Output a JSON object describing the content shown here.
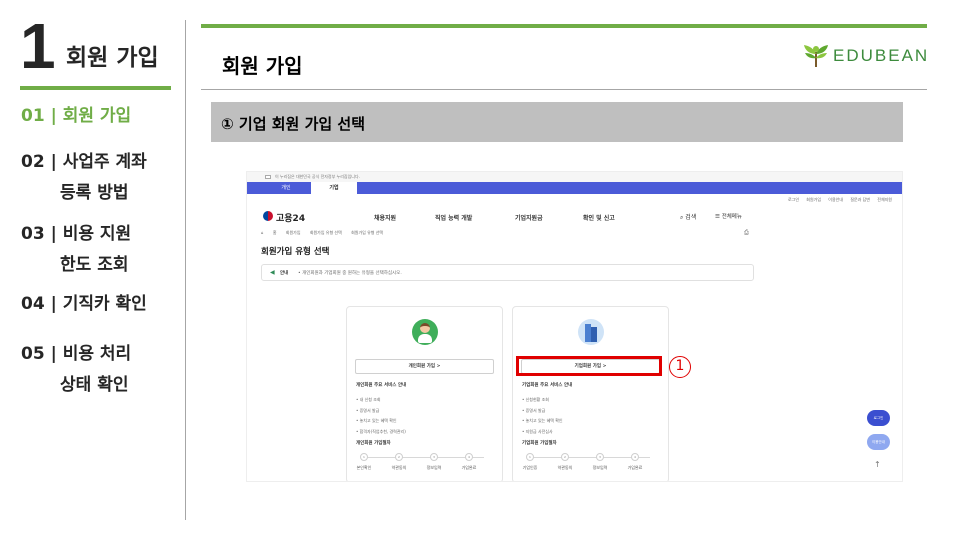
{
  "chapter": {
    "number": "1",
    "title": "회원 가입"
  },
  "nav": [
    {
      "line1": "01 | 회원 가입",
      "line2": "",
      "active": true
    },
    {
      "line1": "02 | 사업주 계좌",
      "line2": "등록 방법",
      "active": false
    },
    {
      "line1": "03 | 비용 지원",
      "line2": "한도 조회",
      "active": false
    },
    {
      "line1": "04 | 기직카 확인",
      "line2": "",
      "active": false
    },
    {
      "line1": "05 | 비용 처리",
      "line2": "상태 확인",
      "active": false
    }
  ],
  "header": {
    "section_title": "회원 가입",
    "logo_text": "EDUBEAN"
  },
  "step": {
    "title": "① 기업 회원 가입 선택"
  },
  "screenshot": {
    "gov_notice": "이 누리집은 대한민국 공식 전자정부 누리집입니다.",
    "tabs": [
      "개인",
      "기업"
    ],
    "util_links": [
      "로그인",
      "회원가입",
      "이용안내",
      "질문과 답변",
      "전체지원"
    ],
    "site_logo": "고용24",
    "menu": [
      "채용지원",
      "직업 능력 개발",
      "기업지원금",
      "확인 및 신고"
    ],
    "search": "검색",
    "all_menu": "전체메뉴",
    "breadcrumb": [
      "홈",
      "회원가입",
      "회원가입 유형 선택",
      "회원가입 유형 선택"
    ],
    "page_title": "회원가입 유형 선택",
    "info_label": "안내",
    "info_text": "• 개인회원과 기업회원 중 원하는 유형을 선택하십시오.",
    "personal": {
      "button": "개인회원 가입  >",
      "services_title": "개인회원 주요 서비스 안내",
      "services": [
        "• 내 신청 조회",
        "• 증명서 발급",
        "• 놓치고 있는 혜택 확인",
        "• 합격자(직업추천, 경력관리)"
      ],
      "process_title": "개인회원 가입절차",
      "process": [
        "본인확인",
        "약관동의",
        "정보입력",
        "가입완료"
      ]
    },
    "corporate": {
      "button": "기업회원 가입  >",
      "services_title": "기업회원 주요 서비스 안내",
      "services": [
        "• 신청현황 조회",
        "• 증명서 발급",
        "• 놓치고 있는 혜택 확인",
        "• 지원금 사전심사"
      ],
      "process_title": "기업회원 가입절차",
      "process": [
        "기업인증",
        "약관동의",
        "정보입력",
        "가입완료"
      ]
    },
    "float_login": "로그인",
    "float_guide": "이용안내",
    "scroll_top": "↑"
  },
  "callout": {
    "number": "1"
  }
}
